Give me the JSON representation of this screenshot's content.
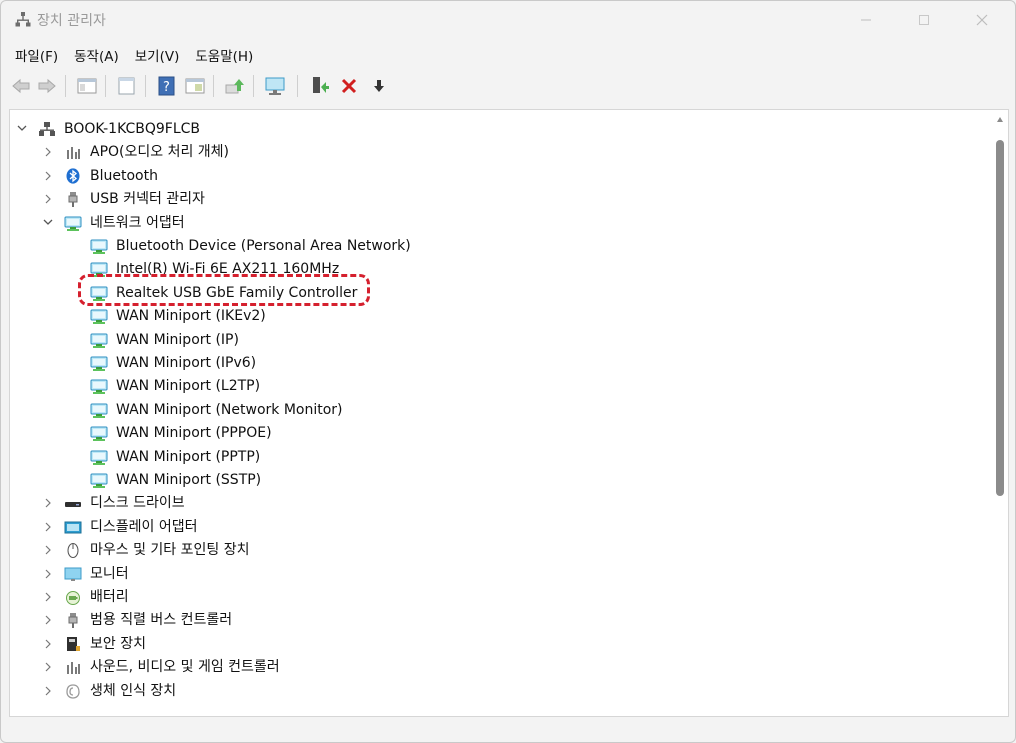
{
  "window": {
    "title": "장치 관리자"
  },
  "menu": [
    {
      "id": "file",
      "label": "파일(F)"
    },
    {
      "id": "action",
      "label": "동작(A)"
    },
    {
      "id": "view",
      "label": "보기(V)"
    },
    {
      "id": "help",
      "label": "도움말(H)"
    }
  ],
  "toolbar": [
    {
      "id": "back",
      "icon": "back-arrow-icon"
    },
    {
      "id": "forward",
      "icon": "forward-arrow-icon"
    },
    {
      "id": "show-hide-console-tree",
      "icon": "console-tree-icon"
    },
    {
      "id": "properties",
      "icon": "properties-icon"
    },
    {
      "id": "help",
      "icon": "help-icon"
    },
    {
      "id": "view-resources",
      "icon": "resources-icon"
    },
    {
      "id": "update-driver",
      "icon": "update-driver-icon"
    },
    {
      "id": "scan-hardware",
      "icon": "scan-hardware-icon"
    },
    {
      "id": "enable-device",
      "icon": "enable-device-icon"
    },
    {
      "id": "uninstall-device",
      "icon": "uninstall-icon"
    },
    {
      "id": "disable-device",
      "icon": "disable-device-icon"
    }
  ],
  "tree": {
    "root": {
      "label": "BOOK-1KCBQ9FLCB",
      "icon": "computer-icon",
      "expanded": true
    },
    "items": [
      {
        "label": "APO(오디오 처리 개체)",
        "icon": "audio-icon",
        "expanded": false,
        "level": 1
      },
      {
        "label": "Bluetooth",
        "icon": "bluetooth-icon",
        "expanded": false,
        "level": 1
      },
      {
        "label": "USB 커넥터 관리자",
        "icon": "usb-icon",
        "expanded": false,
        "level": 1
      },
      {
        "label": "네트워크 어댑터",
        "icon": "network-adapter-icon",
        "expanded": true,
        "level": 1
      },
      {
        "label": "Bluetooth Device (Personal Area Network)",
        "icon": "network-adapter-icon",
        "level": 2
      },
      {
        "label": "Intel(R) Wi-Fi 6E AX211 160MHz",
        "icon": "network-adapter-icon",
        "level": 2
      },
      {
        "label": "Realtek USB GbE Family Controller",
        "icon": "network-adapter-icon",
        "level": 2,
        "highlighted": true
      },
      {
        "label": "WAN Miniport (IKEv2)",
        "icon": "network-adapter-icon",
        "level": 2
      },
      {
        "label": "WAN Miniport (IP)",
        "icon": "network-adapter-icon",
        "level": 2
      },
      {
        "label": "WAN Miniport (IPv6)",
        "icon": "network-adapter-icon",
        "level": 2
      },
      {
        "label": "WAN Miniport (L2TP)",
        "icon": "network-adapter-icon",
        "level": 2
      },
      {
        "label": "WAN Miniport (Network Monitor)",
        "icon": "network-adapter-icon",
        "level": 2
      },
      {
        "label": "WAN Miniport (PPPOE)",
        "icon": "network-adapter-icon",
        "level": 2
      },
      {
        "label": "WAN Miniport (PPTP)",
        "icon": "network-adapter-icon",
        "level": 2
      },
      {
        "label": "WAN Miniport (SSTP)",
        "icon": "network-adapter-icon",
        "level": 2
      },
      {
        "label": "디스크 드라이브",
        "icon": "disk-drive-icon",
        "expanded": false,
        "level": 1
      },
      {
        "label": "디스플레이 어댑터",
        "icon": "display-adapter-icon",
        "expanded": false,
        "level": 1
      },
      {
        "label": "마우스 및 기타 포인팅 장치",
        "icon": "mouse-icon",
        "expanded": false,
        "level": 1
      },
      {
        "label": "모니터",
        "icon": "monitor-icon",
        "expanded": false,
        "level": 1
      },
      {
        "label": "배터리",
        "icon": "battery-icon",
        "expanded": false,
        "level": 1
      },
      {
        "label": "범용 직렬 버스 컨트롤러",
        "icon": "usb-controller-icon",
        "expanded": false,
        "level": 1
      },
      {
        "label": "보안 장치",
        "icon": "security-device-icon",
        "expanded": false,
        "level": 1
      },
      {
        "label": "사운드, 비디오 및 게임 컨트롤러",
        "icon": "sound-icon",
        "expanded": false,
        "level": 1
      },
      {
        "label": "생체 인식 장치",
        "icon": "biometric-icon",
        "expanded": false,
        "level": 1
      }
    ]
  },
  "colors": {
    "highlight_border": "#d5202e",
    "window_bg": "#f3f3f3",
    "tree_bg": "#ffffff",
    "scrollbar": "#8b8b8b"
  }
}
